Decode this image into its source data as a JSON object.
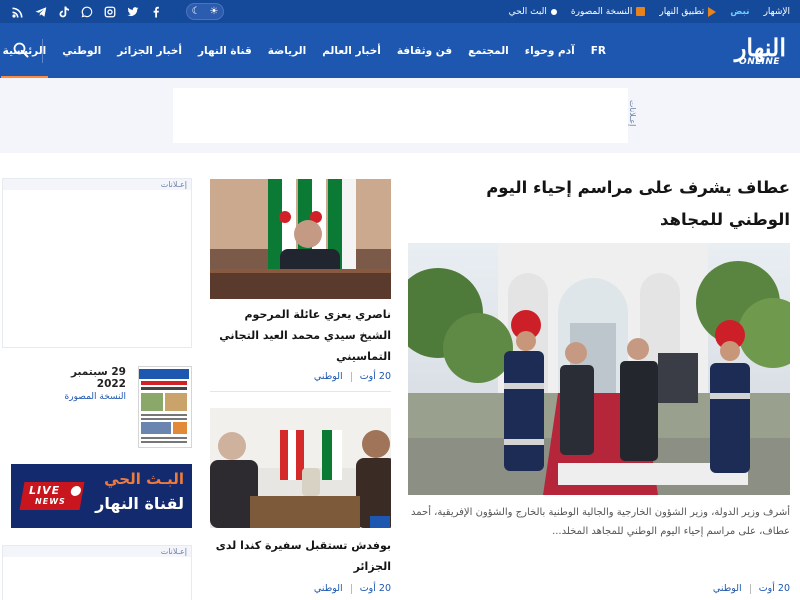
{
  "topbar": {
    "live": "البث الحي",
    "newspaper": "النسخة المصورة",
    "app": "تطبيق النهار",
    "nabd": "نبض",
    "ads": "الإشهار",
    "social_icons": [
      "rss-icon",
      "telegram-icon",
      "tiktok-icon",
      "whatsapp-icon",
      "instagram-icon",
      "twitter-icon",
      "facebook-icon"
    ]
  },
  "logo": {
    "arabic": "النهار",
    "latin": "ONLINE"
  },
  "nav": {
    "items": [
      "الرئيسية",
      "الوطني",
      "أخبار الجزائر",
      "قناة النهار",
      "الرياضة",
      "أخبار العالم",
      "فن وثقافة",
      "المجتمع",
      "آدم وحواء",
      "FR"
    ],
    "active_index": 0
  },
  "ads": {
    "label": "إعـلانات"
  },
  "main_article": {
    "title": "عطاف يشرف على مراسم إحياء اليوم الوطني للمجاهد",
    "excerpt": "أشرف وزير الدولة، وزير الشؤون الخارجية والجالية الوطنية بالخارج والشؤون الإفريقية، أحمد عطاف، على مراسم إحياء اليوم الوطني للمجاهد المخلد...",
    "category": "الوطني",
    "date": "20 أوت"
  },
  "side_articles": [
    {
      "title": "ناصري يعزي عائلة المرحوم الشيخ سيدي محمد العيد التجاني التماسيني",
      "category": "الوطني",
      "date": "20 أوت"
    },
    {
      "title": "بوفدش تستقبل سفيرة كندا لدى الجزائر",
      "category": "الوطني",
      "date": "20 أوت"
    }
  ],
  "newspaper": {
    "date": "29 سبتمبر 2022",
    "label": "النسخة المصورة"
  },
  "live_banner": {
    "line1": "البـث الحي",
    "line2": "لقناة النهار",
    "badge_top": "LIVE",
    "badge_bottom": "NEWS"
  },
  "colors": {
    "topbar": "#15499a",
    "nav": "#1d57b0",
    "accent": "#ff8a3d",
    "link": "#1d57b0"
  }
}
